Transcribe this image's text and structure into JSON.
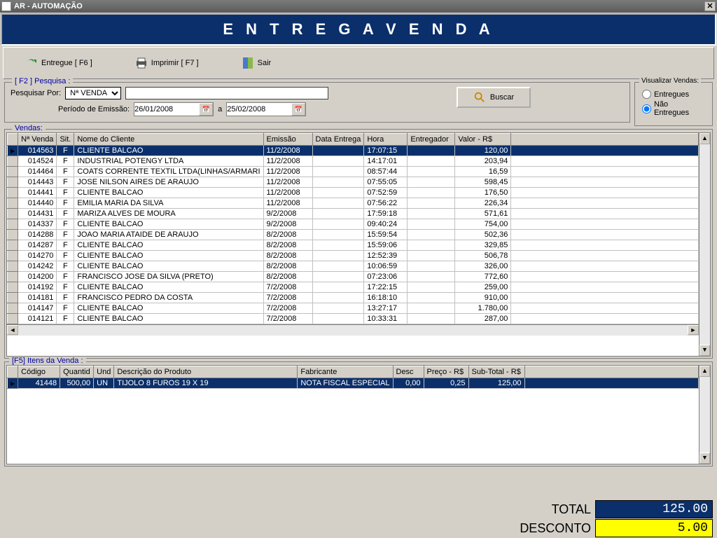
{
  "window": {
    "title": "AR - AUTOMAÇÃO"
  },
  "header": "E N T R E G A    V E N D A",
  "toolbar": {
    "entregue": "Entregue [ F6 ]",
    "imprimir": "Imprimir  [ F7 ]",
    "sair": "Sair"
  },
  "search": {
    "legend": "[ F2 ]  Pesquisa :",
    "pesquisar_por": "Pesquisar Por:",
    "field_option": "Nª VENDA",
    "value": "",
    "periodo_label": "Período de Emissão:",
    "date_from": "26/01/2008",
    "date_sep": "a",
    "date_to": "25/02/2008",
    "buscar": "Buscar"
  },
  "viz": {
    "legend": "Visualizar Vendas:",
    "entregues": "Entregues",
    "nao_entregues": "Não Entregues"
  },
  "vendas": {
    "legend": "Vendas:",
    "cols": [
      "Nª Venda",
      "Sit.",
      "Nome do Cliente",
      "Emissão",
      "Data Entrega",
      "Hora",
      "Entregador",
      "Valor - R$"
    ],
    "rows": [
      {
        "n": "014563",
        "s": "F",
        "c": "CLIENTE BALCAO",
        "e": "11/2/2008",
        "d": "",
        "h": "17:07:15",
        "g": "",
        "v": "120,00",
        "sel": true
      },
      {
        "n": "014524",
        "s": "F",
        "c": "INDUSTRIAL POTENGY LTDA",
        "e": "11/2/2008",
        "d": "",
        "h": "14:17:01",
        "g": "",
        "v": "203,94"
      },
      {
        "n": "014464",
        "s": "F",
        "c": "COATS CORRENTE TEXTIL LTDA(LINHAS/ARMARI",
        "e": "11/2/2008",
        "d": "",
        "h": "08:57:44",
        "g": "",
        "v": "16,59"
      },
      {
        "n": "014443",
        "s": "F",
        "c": "JOSE NILSON AIRES DE ARAUJO",
        "e": "11/2/2008",
        "d": "",
        "h": "07:55:05",
        "g": "",
        "v": "598,45"
      },
      {
        "n": "014441",
        "s": "F",
        "c": "CLIENTE BALCAO",
        "e": "11/2/2008",
        "d": "",
        "h": "07:52:59",
        "g": "",
        "v": "176,50"
      },
      {
        "n": "014440",
        "s": "F",
        "c": "EMILIA MARIA DA SILVA",
        "e": "11/2/2008",
        "d": "",
        "h": "07:56:22",
        "g": "",
        "v": "226,34"
      },
      {
        "n": "014431",
        "s": "F",
        "c": "MARIZA ALVES DE MOURA",
        "e": "9/2/2008",
        "d": "",
        "h": "17:59:18",
        "g": "",
        "v": "571,61"
      },
      {
        "n": "014337",
        "s": "F",
        "c": "CLIENTE BALCAO",
        "e": "9/2/2008",
        "d": "",
        "h": "09:40:24",
        "g": "",
        "v": "754,00"
      },
      {
        "n": "014288",
        "s": "F",
        "c": "JOAO MARIA ATAIDE DE ARAUJO",
        "e": "8/2/2008",
        "d": "",
        "h": "15:59:54",
        "g": "",
        "v": "502,36"
      },
      {
        "n": "014287",
        "s": "F",
        "c": "CLIENTE BALCAO",
        "e": "8/2/2008",
        "d": "",
        "h": "15:59:06",
        "g": "",
        "v": "329,85"
      },
      {
        "n": "014270",
        "s": "F",
        "c": "CLIENTE BALCAO",
        "e": "8/2/2008",
        "d": "",
        "h": "12:52:39",
        "g": "",
        "v": "506,78"
      },
      {
        "n": "014242",
        "s": "F",
        "c": "CLIENTE BALCAO",
        "e": "8/2/2008",
        "d": "",
        "h": "10:06:59",
        "g": "",
        "v": "326,00"
      },
      {
        "n": "014200",
        "s": "F",
        "c": "FRANCISCO JOSE DA SILVA (PRETO)",
        "e": "8/2/2008",
        "d": "",
        "h": "07:23:06",
        "g": "",
        "v": "772,60"
      },
      {
        "n": "014192",
        "s": "F",
        "c": "CLIENTE BALCAO",
        "e": "7/2/2008",
        "d": "",
        "h": "17:22:15",
        "g": "",
        "v": "259,00"
      },
      {
        "n": "014181",
        "s": "F",
        "c": "FRANCISCO PEDRO DA COSTA",
        "e": "7/2/2008",
        "d": "",
        "h": "16:18:10",
        "g": "",
        "v": "910,00"
      },
      {
        "n": "014147",
        "s": "F",
        "c": "CLIENTE BALCAO",
        "e": "7/2/2008",
        "d": "",
        "h": "13:27:17",
        "g": "",
        "v": "1.780,00"
      },
      {
        "n": "014121",
        "s": "F",
        "c": "CLIENTE BALCAO",
        "e": "7/2/2008",
        "d": "",
        "h": "10:33:31",
        "g": "",
        "v": "287,00"
      }
    ]
  },
  "itens": {
    "legend": "[F5]  Itens da Venda  :",
    "cols": [
      "Código",
      "Quantid",
      "Und",
      "Descrição do Produto",
      "Fabricante",
      "Desc",
      "Preço - R$",
      "Sub-Total - R$"
    ],
    "rows": [
      {
        "cod": "41448",
        "q": "500,00",
        "u": "UN",
        "d": "TIJOLO 8 FUROS 19 X 19",
        "f": "NOTA FISCAL ESPECIAL",
        "dc": "0,00",
        "p": "0,25",
        "st": "125,00",
        "sel": true
      }
    ]
  },
  "totals": {
    "total_label": "TOTAL",
    "total_value": "125.00",
    "desconto_label": "DESCONTO",
    "desconto_value": "5.00"
  }
}
